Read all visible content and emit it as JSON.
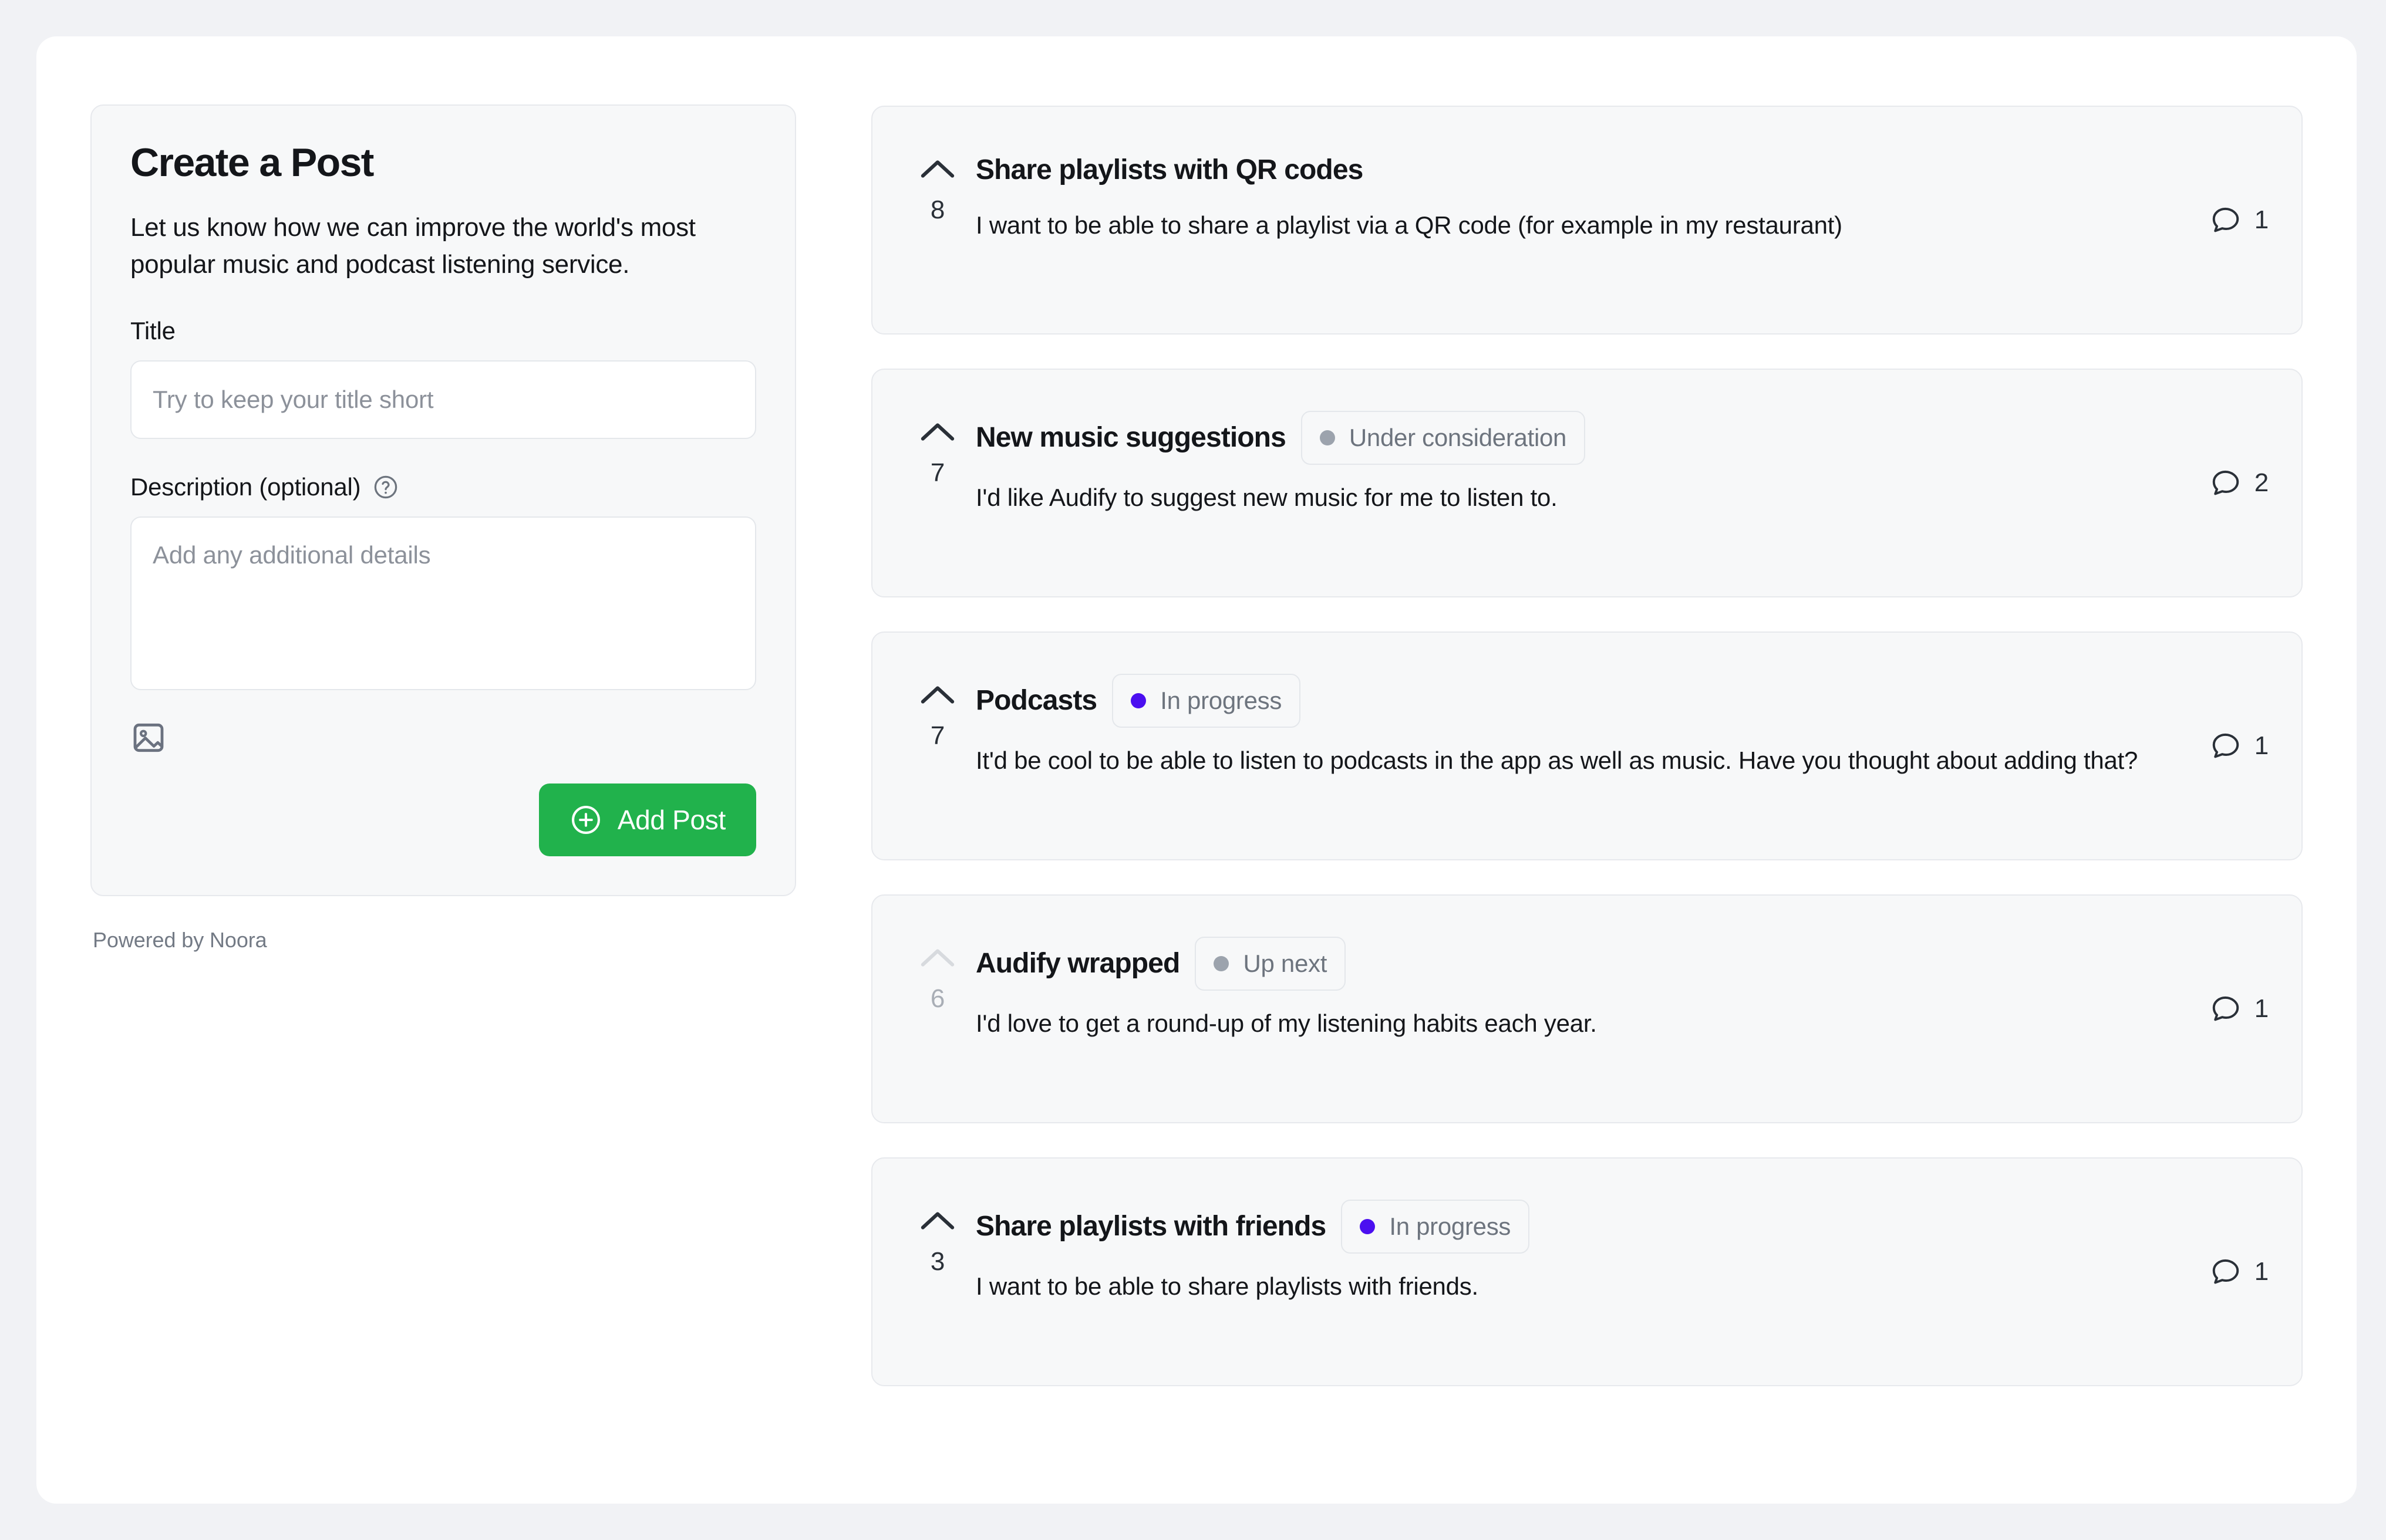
{
  "theme": {
    "page_background": "#f1f2f5",
    "surface": "#ffffff",
    "card_background": "#f7f8f9",
    "card_border": "#e7e9ed",
    "accent_green": "#21b24c",
    "status_purple": "#4b0ff0",
    "status_gray": "#9ca3ad",
    "text_primary": "#14161a",
    "text_muted": "#6d747e"
  },
  "create_post": {
    "title": "Create a Post",
    "subtitle": "Let us know how we can improve the world's most popular music and podcast listening service.",
    "title_label": "Title",
    "title_value": "",
    "title_placeholder": "Try to keep your title short",
    "description_label": "Description (optional)",
    "description_help_icon": "question-circle-icon",
    "description_value": "",
    "description_placeholder": "Add any additional details",
    "attach_image_icon": "image-icon",
    "submit_label": "Add Post",
    "submit_icon": "plus-circle-icon",
    "powered_by": "Powered by Noora"
  },
  "posts": [
    {
      "votes": "8",
      "vote_icon": "chevron-up-icon",
      "voted": false,
      "title": "Share playlists with QR codes",
      "status": null,
      "status_color": null,
      "description": "I want to be able to share a playlist via a QR code (for example in my restaurant)",
      "comments": "1",
      "comment_icon": "comment-bubble-icon"
    },
    {
      "votes": "7",
      "vote_icon": "chevron-up-icon",
      "voted": false,
      "title": "New music suggestions",
      "status": "Under consideration",
      "status_color": "#9ca3ad",
      "description": "I'd like Audify to suggest new music for me to listen to.",
      "comments": "2",
      "comment_icon": "comment-bubble-icon"
    },
    {
      "votes": "7",
      "vote_icon": "chevron-up-icon",
      "voted": false,
      "title": "Podcasts",
      "status": "In progress",
      "status_color": "#4b0ff0",
      "description": "It'd be cool to be able to listen to podcasts in the app as well as music. Have you thought about adding that?",
      "comments": "1",
      "comment_icon": "comment-bubble-icon"
    },
    {
      "votes": "6",
      "vote_icon": "chevron-up-icon",
      "voted": true,
      "title": "Audify wrapped",
      "status": "Up next",
      "status_color": "#9ca3ad",
      "description": "I'd love to get a round-up of my listening habits each year.",
      "comments": "1",
      "comment_icon": "comment-bubble-icon"
    },
    {
      "votes": "3",
      "vote_icon": "chevron-up-icon",
      "voted": false,
      "title": "Share playlists with friends",
      "status": "In progress",
      "status_color": "#4b0ff0",
      "description": "I want to be able to share playlists with friends.",
      "comments": "1",
      "comment_icon": "comment-bubble-icon"
    }
  ]
}
